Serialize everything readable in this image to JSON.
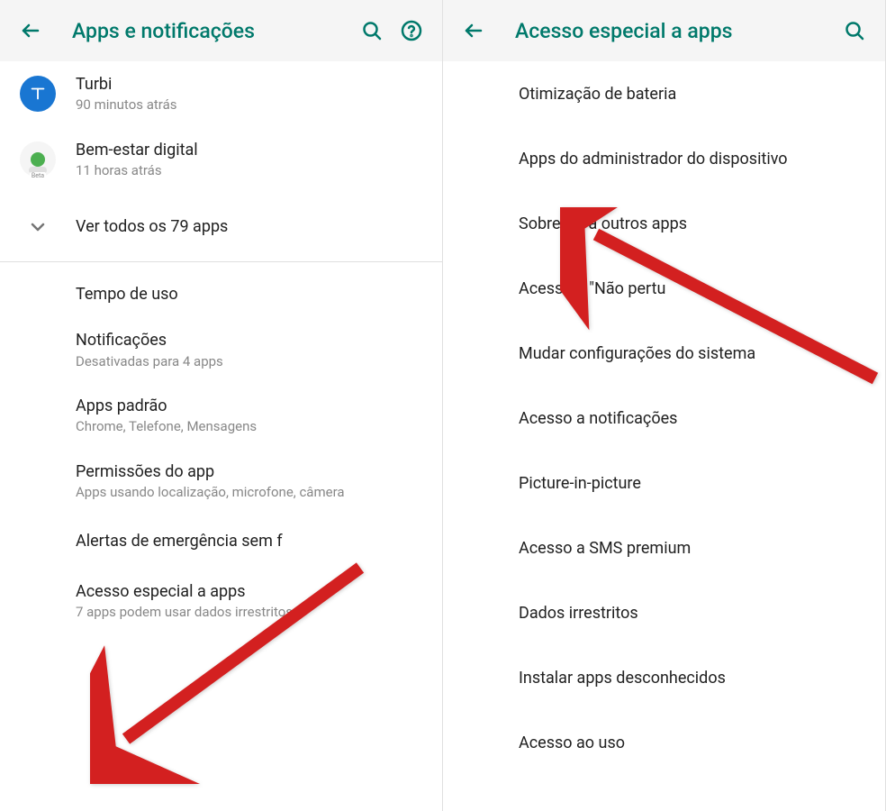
{
  "left": {
    "title": "Apps e notificações",
    "apps": [
      {
        "name": "Turbi",
        "sub": "90 minutos atrás"
      },
      {
        "name": "Bem-estar digital",
        "sub": "11 horas atrás"
      }
    ],
    "expand": "Ver todos os 79 apps",
    "sections": [
      {
        "title": "Tempo de uso",
        "sub": ""
      },
      {
        "title": "Notificações",
        "sub": "Desativadas para 4 apps"
      },
      {
        "title": "Apps padrão",
        "sub": "Chrome, Telefone, Mensagens"
      },
      {
        "title": "Permissões do app",
        "sub": "Apps usando localização, microfone, câmera"
      },
      {
        "title": "Alertas de emergência sem f",
        "sub": ""
      },
      {
        "title": "Acesso especial a apps",
        "sub": "7 apps podem usar dados irrestritos"
      }
    ]
  },
  "right": {
    "title": "Acesso especial a apps",
    "items": [
      "Otimização de bateria",
      "Apps do administrador do dispositivo",
      "Sobrepor a outros apps",
      "Acesso a \"Não pertu",
      "Mudar configurações do sistema",
      "Acesso a notificações",
      "Picture-in-picture",
      "Acesso a SMS premium",
      "Dados irrestritos",
      "Instalar apps desconhecidos",
      "Acesso ao uso"
    ]
  }
}
